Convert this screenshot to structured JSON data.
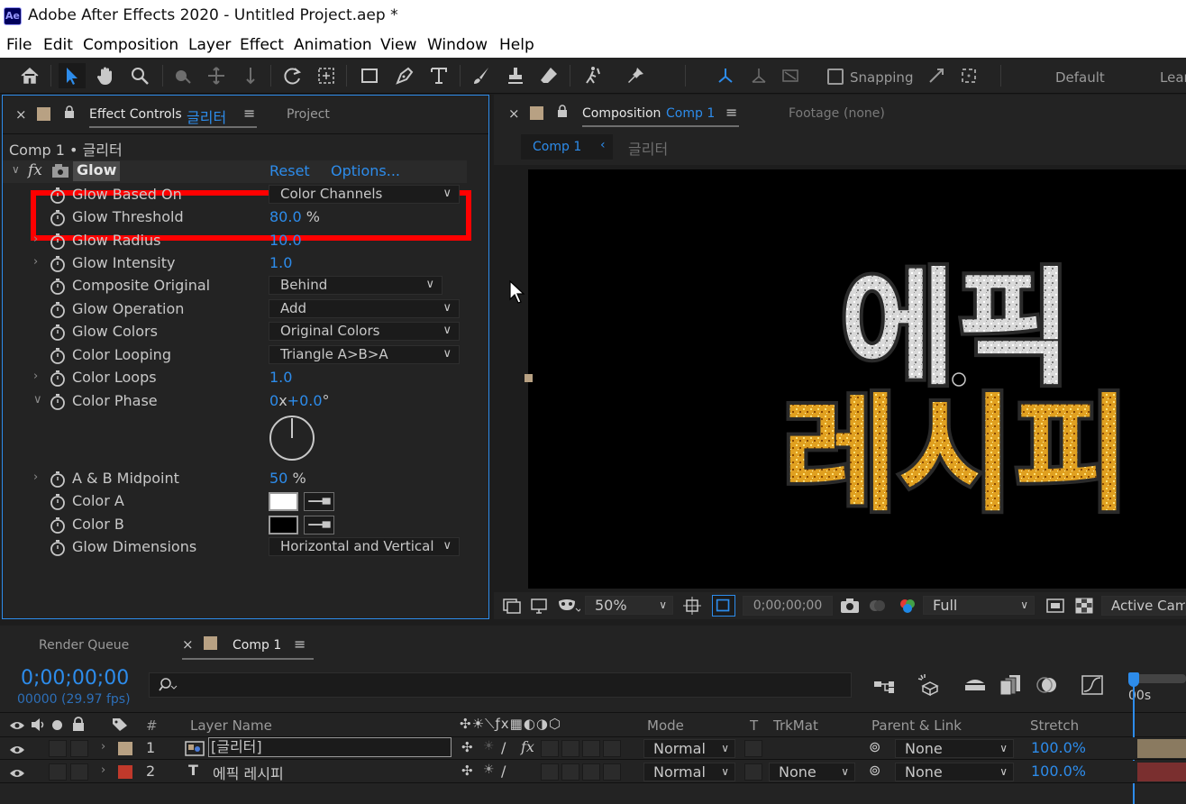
{
  "app": {
    "logo": "Ae",
    "title": "Adobe After Effects 2020 - Untitled Project.aep *"
  },
  "menu": [
    "File",
    "Edit",
    "Composition",
    "Layer",
    "Effect",
    "Animation",
    "View",
    "Window",
    "Help"
  ],
  "toolbar": {
    "snapping_label": "Snapping",
    "workspace_default": "Default",
    "workspace_learn": "Lear",
    "tools": [
      "home-icon",
      "selection-tool-icon",
      "hand-tool-icon",
      "zoom-tool-icon",
      "orbit-camera-icon",
      "pan-camera-icon",
      "dolly-camera-icon",
      "rotation-tool-icon",
      "pan-behind-icon",
      "rectangle-tool-icon",
      "pen-tool-icon",
      "type-tool-icon",
      "brush-tool-icon",
      "clone-stamp-icon",
      "eraser-icon",
      "roto-brush-icon",
      "puppet-pin-icon"
    ]
  },
  "effect_controls": {
    "tab_label": "Effect Controls",
    "tab_layer": "글리터",
    "project_tab": "Project",
    "breadcrumb": "Comp 1 • 글리터",
    "effect_name": "Glow",
    "fx_label": "fx",
    "reset_label": "Reset",
    "options_label": "Options...",
    "properties": [
      {
        "name": "Glow Based On",
        "value": "Color Channels",
        "kind": "dropdown"
      },
      {
        "name": "Glow Threshold",
        "value": "80.0",
        "unit": "%",
        "kind": "number"
      },
      {
        "name": "Glow Radius",
        "value": "10.0",
        "kind": "number"
      },
      {
        "name": "Glow Intensity",
        "value": "1.0",
        "kind": "number"
      },
      {
        "name": "Composite Original",
        "value": "Behind",
        "kind": "dropdown"
      },
      {
        "name": "Glow Operation",
        "value": "Add",
        "kind": "dropdown"
      },
      {
        "name": "Glow Colors",
        "value": "Original Colors",
        "kind": "dropdown"
      },
      {
        "name": "Color Looping",
        "value": "Triangle A>B>A",
        "kind": "dropdown"
      },
      {
        "name": "Color Loops",
        "value": "1.0",
        "kind": "number"
      },
      {
        "name": "Color Phase",
        "value_rev": "0",
        "value_x": "x",
        "value_deg": "+0.0",
        "unit": "°",
        "kind": "angle"
      },
      {
        "name": "A & B Midpoint",
        "value": "50",
        "unit": "%",
        "kind": "number"
      },
      {
        "name": "Color A",
        "color": "#ffffff",
        "kind": "color"
      },
      {
        "name": "Color B",
        "color": "#000000",
        "kind": "color"
      },
      {
        "name": "Glow Dimensions",
        "value": "Horizontal and Vertical",
        "kind": "dropdown"
      }
    ]
  },
  "composition_panel": {
    "tab_label": "Composition",
    "tab_comp": "Comp 1",
    "footage_label": "Footage",
    "footage_value": "(none)",
    "flow_comp": "Comp 1",
    "flow_layer": "글리터",
    "viewer_text_top": "에픽",
    "viewer_text_bottom": "레시피",
    "zoom": "50%",
    "timecode": "0;00;00;00",
    "resolution": "Full",
    "camera": "Active Came"
  },
  "timeline": {
    "render_queue_tab": "Render Queue",
    "comp_tab": "Comp 1",
    "current_time": "0;00;00;00",
    "frame_info": "00000 (29.97 fps)",
    "search_icon": "search-icon",
    "ruler_label": "00s",
    "columns": {
      "hash": "#",
      "layer_name": "Layer Name",
      "mode": "Mode",
      "t": "T",
      "trkmat": "TrkMat",
      "parent": "Parent & Link",
      "stretch": "Stretch"
    },
    "layers": [
      {
        "index": "1",
        "name": "[글리터]",
        "label_color": "#b8a183",
        "mode": "Normal",
        "trkmat": "",
        "parent": "None",
        "stretch": "100.0%",
        "type": "precomp"
      },
      {
        "index": "2",
        "name": "에픽 레시피",
        "label_color": "#c0392b",
        "mode": "Normal",
        "trkmat": "None",
        "parent": "None",
        "stretch": "100.0%",
        "type": "text",
        "type_glyph": "T"
      }
    ]
  },
  "colors": {
    "accent": "#2d8ceb",
    "highlight_box": "#ff0000",
    "panel": "#232323"
  }
}
